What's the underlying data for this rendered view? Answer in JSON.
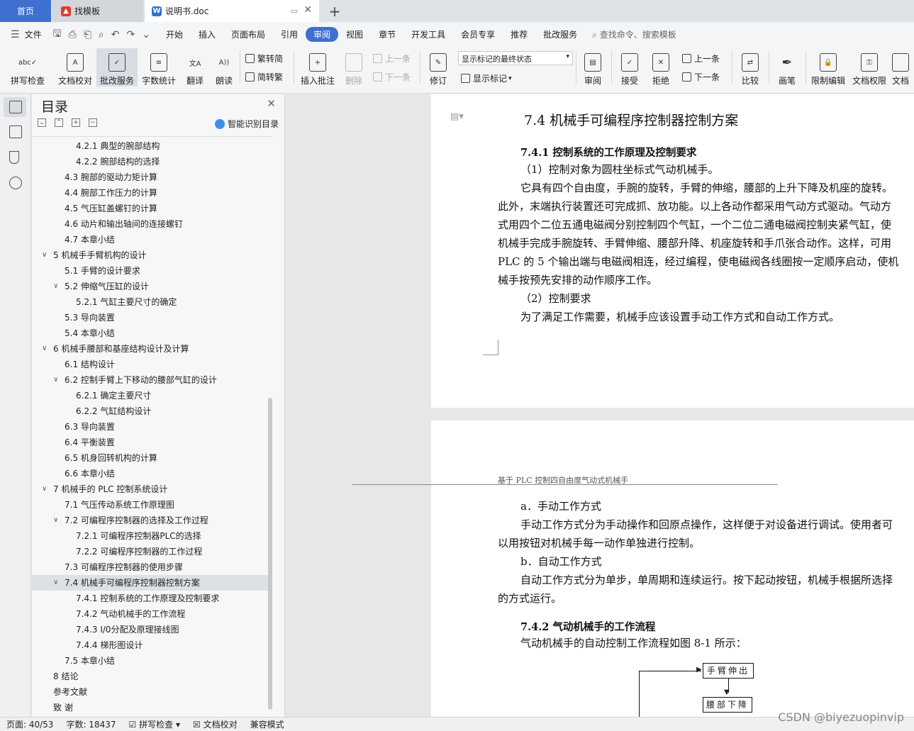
{
  "tabs": {
    "home": "首页",
    "template": "找模板",
    "doc": "说明书.doc",
    "add": "+"
  },
  "menu": {
    "file": "文件",
    "items": [
      "开始",
      "插入",
      "页面布局",
      "引用",
      "审阅",
      "视图",
      "章节",
      "开发工具",
      "会员专享",
      "推荐",
      "批改服务"
    ],
    "active": "审阅",
    "search": "查找命令、搜索模板"
  },
  "ribbon": {
    "spell": "拼写检查",
    "proofread": "文档校对",
    "correct": "批改服务",
    "wordcount": "字数统计",
    "translate": "翻译",
    "read": "朗读",
    "trad": "繁转简",
    "simp": "简转繁",
    "insert_comment": "插入批注",
    "delete": "删除",
    "prev_comment": "上一条",
    "next_comment": "下一条",
    "revise": "修订",
    "markup_state": "显示标记的最终状态",
    "show_markup": "显示标记",
    "review": "审阅",
    "accept": "接受",
    "reject": "拒绝",
    "prev_change": "上一条",
    "next_change": "下一条",
    "compare": "比较",
    "pen": "画笔",
    "restrict": "限制编辑",
    "rights": "文档权限",
    "more": "文档"
  },
  "toc": {
    "title": "目录",
    "smart": "智能识别目录",
    "items": [
      {
        "text": "4.2.1  典型的腕部结构",
        "level": 3
      },
      {
        "text": "4.2.2  腕部结构的选择",
        "level": 3
      },
      {
        "text": "4.3  腕部的驱动力矩计算",
        "level": 2
      },
      {
        "text": "4.4  腕部工作压力的计算",
        "level": 2
      },
      {
        "text": "4.5  气压缸盖螺钉的计算",
        "level": 2
      },
      {
        "text": "4.6  动片和输出轴间的连接螺钉",
        "level": 2
      },
      {
        "text": "4.7  本章小结",
        "level": 2
      },
      {
        "text": "5  机械手手臂机构的设计",
        "level": 1
      },
      {
        "text": "5.1  手臂的设计要求",
        "level": 2
      },
      {
        "text": "5.2  伸缩气压缸的设计",
        "level": 2
      },
      {
        "text": "5.2.1  气缸主要尺寸的确定",
        "level": 3
      },
      {
        "text": "5.3  导向装置",
        "level": 2
      },
      {
        "text": "5.4  本章小结",
        "level": 2
      },
      {
        "text": "6  机械手腰部和基座结构设计及计算",
        "level": 1
      },
      {
        "text": "6.1  结构设计",
        "level": 2
      },
      {
        "text": "6.2  控制手臂上下移动的腰部气缸的设计",
        "level": 2
      },
      {
        "text": "6.2.1  确定主要尺寸",
        "level": 3
      },
      {
        "text": "6.2.2    气缸结构设计",
        "level": 3
      },
      {
        "text": "6.3  导向装置",
        "level": 2
      },
      {
        "text": "6.4  平衡装置",
        "level": 2
      },
      {
        "text": "6.5  机身回转机构的计算",
        "level": 2
      },
      {
        "text": "6.6  本章小结",
        "level": 2
      },
      {
        "text": "7  机械手的 PLC 控制系统设计",
        "level": 1
      },
      {
        "text": "7.1  气压传动系统工作原理图",
        "level": 2
      },
      {
        "text": "7.2  可编程序控制器的选择及工作过程",
        "level": 2
      },
      {
        "text": "7.2.1  可编程序控制器PLC的选择",
        "level": 3
      },
      {
        "text": "7.2.2  可编程序控制器的工作过程",
        "level": 3
      },
      {
        "text": "7.3  可编程序控制器的使用步骤",
        "level": 2
      },
      {
        "text": "7.4  机械手可编程序控制器控制方案",
        "level": 2
      },
      {
        "text": "7.4.1  控制系统的工作原理及控制要求",
        "level": 3
      },
      {
        "text": "7.4.2    气动机械手的工作流程",
        "level": 3
      },
      {
        "text": "7.4.3    I/0分配及原理接线图",
        "level": 3
      },
      {
        "text": "7.4.4    梯形图设计",
        "level": 3
      },
      {
        "text": "7.5  本章小结",
        "level": 2
      },
      {
        "text": "8  结论",
        "level": 0
      },
      {
        "text": "参考文献",
        "level": 0
      },
      {
        "text": "致    谢",
        "level": 0
      }
    ]
  },
  "doc": {
    "heading": "7.4  机械手可编程序控制器控制方案",
    "sub1": "7.4.1  控制系统的工作原理及控制要求",
    "p1": "（1）控制对象为圆柱坐标式气动机械手。",
    "lines": [
      "它具有四个自由度，手腕的旋转，手臂的伸缩，腰部的上升下降及机座的旋转。",
      "此外，末端执行装置还可完成抓、放功能。以上各动作都采用气动方式驱动。气动方",
      "式用四个二位五通电磁阀分别控制四个气缸，一个二位二通电磁阀控制夹紧气缸，使",
      "机械手完成手腕旋转、手臂伸缩、腰部升降、机座旋转和手爪张合动作。这样，可用",
      "PLC 的 5 个输出端与电磁阀相连，经过编程，使电磁阀各线圈按一定顺序启动，使机",
      "械手按预先安排的动作顺序工作。"
    ],
    "p2": "（2）控制要求",
    "p3": "为了满足工作需要，机械手应该设置手动工作方式和自动工作方式。",
    "page_header": "基于 PLC 控制四自由度气动式机械手",
    "a_title": "a．手动工作方式",
    "a_lines": [
      "手动工作方式分为手动操作和回原点操作，这样便于对设备进行调试。使用者可",
      "以用按钮对机械手每一动作单独进行控制。"
    ],
    "b_title": "b．自动工作方式",
    "b_lines": [
      "自动工作方式分为单步，单周期和连续运行。按下起动按钮，机械手根据所选择",
      "的方式运行。"
    ],
    "sub2": "7.4.2    气动机械手的工作流程",
    "p4": "气动机械手的自动控制工作流程如图 8-1 所示：",
    "flow1": "手臂伸出",
    "flow2": "腰部下降"
  },
  "status": {
    "page": "页面: 40/53",
    "words": "字数: 18437",
    "spell": "拼写检查",
    "proof": "文档校对",
    "compat": "兼容模式"
  },
  "watermark": "CSDN @biyezuopinvip"
}
